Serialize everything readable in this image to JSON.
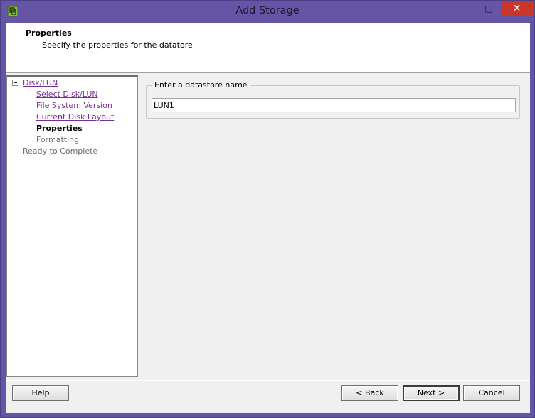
{
  "window": {
    "title": "Add Storage",
    "min_glyph": "–",
    "max_glyph": "□",
    "close_glyph": "✕",
    "app_icon": "vsphere-app-icon"
  },
  "header": {
    "title": "Properties",
    "subtitle": "Specify the properties for the datatore"
  },
  "nav": {
    "collapse_icon": "collapse-minus-icon",
    "items": [
      {
        "label": "Disk/LUN",
        "state": "link"
      },
      {
        "label": "Select Disk/LUN",
        "state": "link"
      },
      {
        "label": "File System Version",
        "state": "link"
      },
      {
        "label": "Current Disk Layout",
        "state": "link"
      },
      {
        "label": "Properties",
        "state": "current"
      },
      {
        "label": "Formatting",
        "state": "pending"
      },
      {
        "label": "Ready to Complete",
        "state": "pending"
      }
    ]
  },
  "main": {
    "group_label": "Enter a datastore name",
    "datastore_name": "LUN1"
  },
  "buttons": {
    "help": "Help",
    "back": "< Back",
    "next": "Next >",
    "cancel": "Cancel"
  },
  "colors": {
    "frame": "#6655a6",
    "close_button": "#c9372b",
    "link": "#7a2d9a"
  }
}
